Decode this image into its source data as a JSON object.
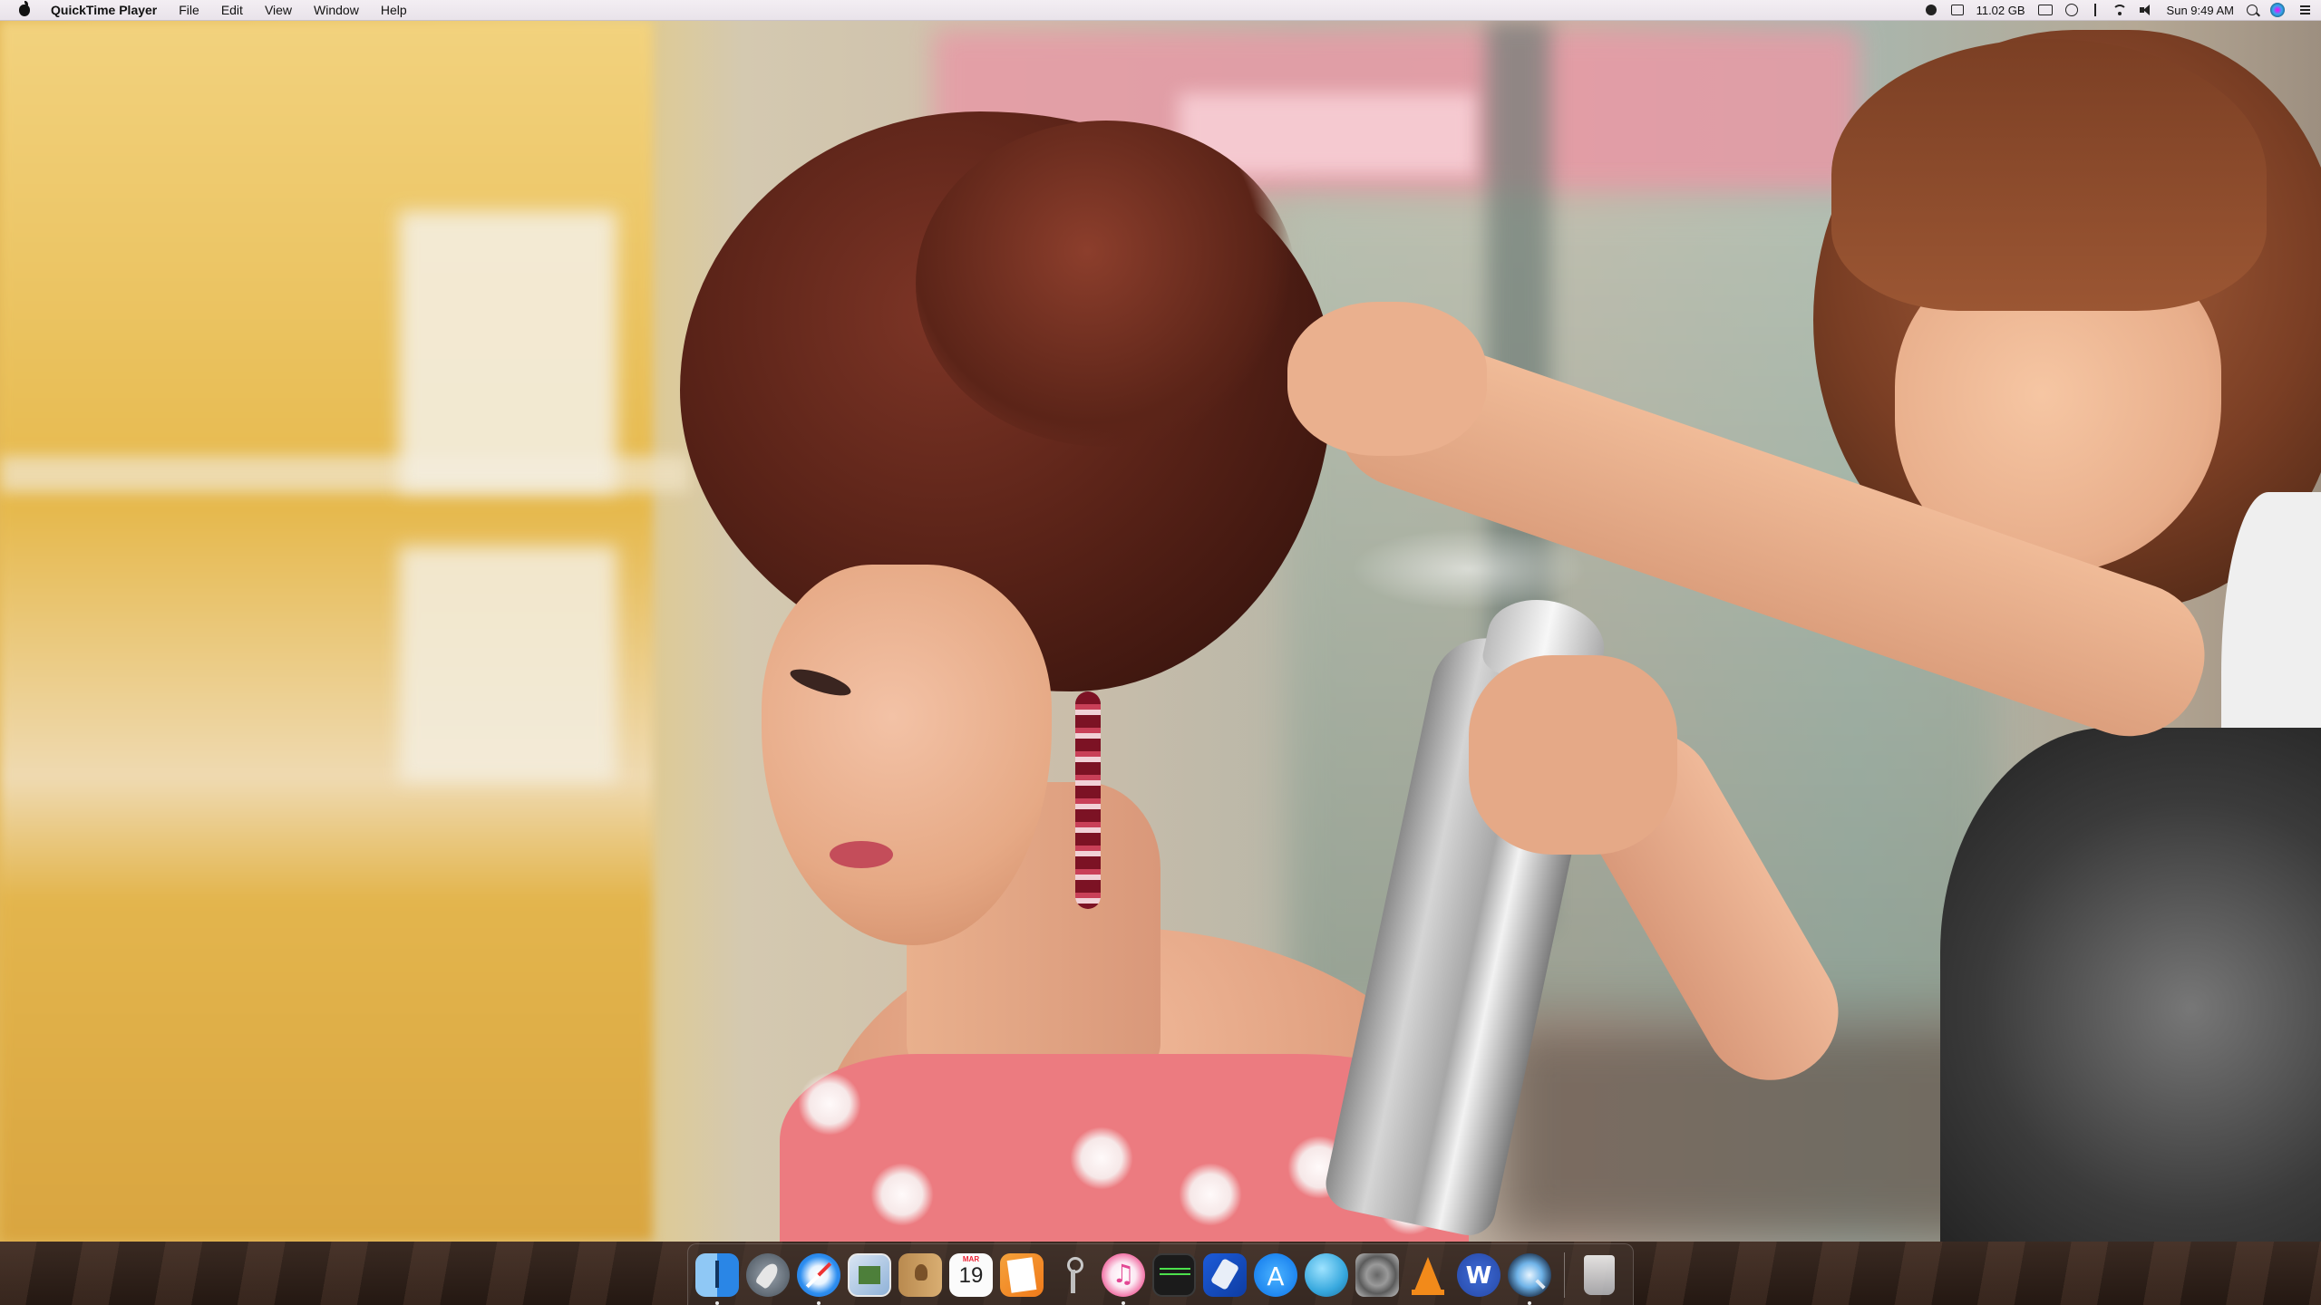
{
  "menubar": {
    "app_name": "QuickTime Player",
    "menus": [
      "File",
      "Edit",
      "View",
      "Window",
      "Help"
    ],
    "status": {
      "memory": "11.02 GB",
      "clock": "Sun 9:49 AM"
    }
  },
  "video": {
    "app": "QuickTime Player"
  },
  "dock": {
    "items": [
      {
        "name": "finder",
        "icon": "finder-icon",
        "running": true
      },
      {
        "name": "launchpad",
        "icon": "launchpad-icon",
        "running": false
      },
      {
        "name": "safari",
        "icon": "safari-icon",
        "running": true
      },
      {
        "name": "preview",
        "icon": "preview-icon",
        "running": false
      },
      {
        "name": "contacts",
        "icon": "contacts-icon",
        "running": false
      },
      {
        "name": "calendar",
        "icon": "calendar-icon",
        "running": false
      },
      {
        "name": "pages",
        "icon": "pages-icon",
        "running": false
      },
      {
        "name": "keychain",
        "icon": "keychain-icon",
        "running": false
      },
      {
        "name": "itunes",
        "icon": "itunes-icon",
        "running": true
      },
      {
        "name": "activity-monitor",
        "icon": "activity-monitor-icon",
        "running": false
      },
      {
        "name": "xcode",
        "icon": "xcode-icon",
        "running": false
      },
      {
        "name": "app-store",
        "icon": "app-store-icon",
        "running": false
      },
      {
        "name": "blue-app",
        "icon": "blue-circle-icon",
        "running": false
      },
      {
        "name": "system-preferences",
        "icon": "system-preferences-icon",
        "running": false
      },
      {
        "name": "vlc",
        "icon": "vlc-icon",
        "running": false
      },
      {
        "name": "word",
        "icon": "word-icon",
        "running": false
      },
      {
        "name": "quicktime",
        "icon": "quicktime-icon",
        "running": true
      },
      {
        "name": "trash",
        "icon": "trash-icon",
        "running": false
      }
    ],
    "calendar": {
      "month": "MAR",
      "day": "19"
    }
  }
}
